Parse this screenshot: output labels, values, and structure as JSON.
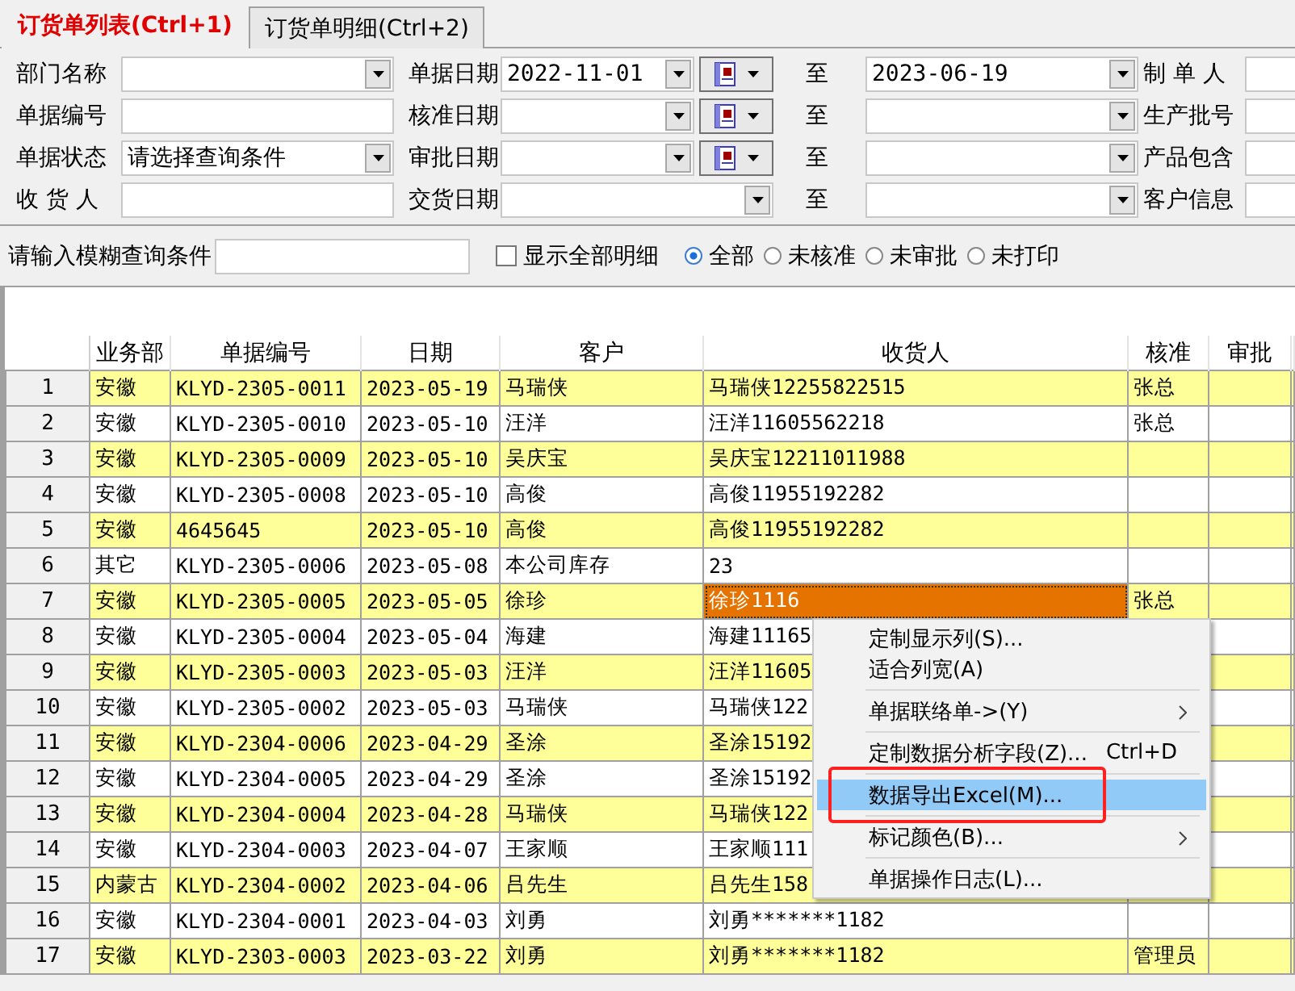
{
  "tabs": [
    {
      "label": "订货单列表(Ctrl+1)",
      "selected": true
    },
    {
      "label": "订货单明细(Ctrl+2)",
      "selected": false
    }
  ],
  "form": {
    "rows": [
      {
        "field": {
          "label": "部门名称",
          "kind": "combo"
        },
        "date": {
          "label": "单据日期",
          "value": "2022-11-01",
          "calendar": true
        },
        "to": {
          "label": "至",
          "value": "2023-06-19"
        },
        "extra": {
          "label": "制 单 人"
        }
      },
      {
        "field": {
          "label": "单据编号",
          "kind": "text"
        },
        "date": {
          "label": "核准日期",
          "calendar": true
        },
        "to": {
          "label": "至"
        },
        "extra": {
          "label": "生产批号"
        }
      },
      {
        "field": {
          "label": "单据状态",
          "kind": "combo",
          "value": "请选择查询条件"
        },
        "date": {
          "label": "审批日期",
          "calendar": true
        },
        "to": {
          "label": "至"
        },
        "extra": {
          "label": "产品包含"
        }
      },
      {
        "field": {
          "label": "收 货 人",
          "kind": "text"
        },
        "date": {
          "label": "交货日期",
          "calendar": false
        },
        "to": {
          "label": "至"
        },
        "extra": {
          "label": "客户信息"
        }
      }
    ]
  },
  "filter": {
    "label": "请输入模糊查询条件",
    "checkbox": {
      "label": "显示全部明细",
      "checked": false
    },
    "radios": [
      {
        "label": "全部",
        "selected": true
      },
      {
        "label": "未核准",
        "selected": false
      },
      {
        "label": "未审批",
        "selected": false
      },
      {
        "label": "未打印",
        "selected": false
      }
    ]
  },
  "grid": {
    "columns": [
      "业务部",
      "单据编号",
      "日期",
      "客户",
      "收货人",
      "核准",
      "审批"
    ],
    "rows": [
      {
        "number": "1",
        "selected": false,
        "cells": [
          "安徽",
          "KLYD-2305-0011",
          "2023-05-19",
          "马瑞侠",
          "马瑞侠12255822515",
          "张总",
          ""
        ]
      },
      {
        "number": "2",
        "selected": false,
        "cells": [
          "安徽",
          "KLYD-2305-0010",
          "2023-05-10",
          "汪洋",
          "汪洋11605562218",
          "张总",
          ""
        ]
      },
      {
        "number": "3",
        "selected": false,
        "cells": [
          "安徽",
          "KLYD-2305-0009",
          "2023-05-10",
          "吴庆宝",
          "吴庆宝12211011988",
          "",
          ""
        ]
      },
      {
        "number": "4",
        "selected": false,
        "cells": [
          "安徽",
          "KLYD-2305-0008",
          "2023-05-10",
          "高俊",
          "高俊11955192282",
          "",
          ""
        ]
      },
      {
        "number": "5",
        "selected": false,
        "cells": [
          "安徽",
          "4645645",
          "2023-05-10",
          "高俊",
          "高俊11955192282",
          "",
          ""
        ]
      },
      {
        "number": "6",
        "selected": false,
        "cells": [
          "其它",
          "KLYD-2305-0006",
          "2023-05-08",
          "本公司库存",
          "23",
          "",
          ""
        ]
      },
      {
        "number": "7",
        "selected": true,
        "cells": [
          "安徽",
          "KLYD-2305-0005",
          "2023-05-05",
          "徐珍",
          "徐珍1116",
          "张总",
          ""
        ]
      },
      {
        "number": "8",
        "selected": false,
        "cells": [
          "安徽",
          "KLYD-2305-0004",
          "2023-05-04",
          "海建",
          "海建11165",
          "",
          ""
        ]
      },
      {
        "number": "9",
        "selected": false,
        "cells": [
          "安徽",
          "KLYD-2305-0003",
          "2023-05-03",
          "汪洋",
          "汪洋11605",
          "",
          ""
        ]
      },
      {
        "number": "10",
        "selected": false,
        "cells": [
          "安徽",
          "KLYD-2305-0002",
          "2023-05-03",
          "马瑞侠",
          "马瑞侠122",
          "",
          ""
        ]
      },
      {
        "number": "11",
        "selected": false,
        "cells": [
          "安徽",
          "KLYD-2304-0006",
          "2023-04-29",
          "圣涂",
          "圣涂15192",
          "",
          ""
        ]
      },
      {
        "number": "12",
        "selected": false,
        "cells": [
          "安徽",
          "KLYD-2304-0005",
          "2023-04-29",
          "圣涂",
          "圣涂15192",
          "",
          ""
        ]
      },
      {
        "number": "13",
        "selected": false,
        "cells": [
          "安徽",
          "KLYD-2304-0004",
          "2023-04-28",
          "马瑞侠",
          "马瑞侠122",
          "",
          ""
        ]
      },
      {
        "number": "14",
        "selected": false,
        "cells": [
          "安徽",
          "KLYD-2304-0003",
          "2023-04-07",
          "王家顺",
          "王家顺111",
          "",
          ""
        ]
      },
      {
        "number": "15",
        "selected": false,
        "cells": [
          "内蒙古",
          "KLYD-2304-0002",
          "2023-04-06",
          "吕先生",
          "吕先生158",
          "",
          ""
        ]
      },
      {
        "number": "16",
        "selected": false,
        "cells": [
          "安徽",
          "KLYD-2304-0001",
          "2023-04-03",
          "刘勇",
          "刘勇*******1182",
          "",
          ""
        ]
      },
      {
        "number": "17",
        "selected": false,
        "cells": [
          "安徽",
          "KLYD-2303-0003",
          "2023-03-22",
          "刘勇",
          "刘勇*******1182",
          "管理员",
          ""
        ]
      }
    ]
  },
  "menu": {
    "items": [
      {
        "kind": "item",
        "label": "定制显示列(S)...",
        "selected": false,
        "annotated": false,
        "submenu": false
      },
      {
        "kind": "item",
        "label": "适合列宽(A)",
        "selected": false,
        "annotated": false,
        "submenu": false
      },
      {
        "kind": "separator"
      },
      {
        "kind": "item",
        "label": "单据联络单->(Y)",
        "selected": false,
        "annotated": false,
        "submenu": true
      },
      {
        "kind": "separator"
      },
      {
        "kind": "item",
        "label": "定制数据分析字段(Z)...",
        "shortcut": "Ctrl+D",
        "selected": false,
        "annotated": false,
        "submenu": false
      },
      {
        "kind": "separator"
      },
      {
        "kind": "item",
        "label": "数据导出Excel(M)...",
        "selected": true,
        "annotated": true,
        "submenu": false
      },
      {
        "kind": "separator"
      },
      {
        "kind": "item",
        "label": "标记颜色(B)...",
        "selected": false,
        "annotated": false,
        "submenu": true
      },
      {
        "kind": "separator"
      },
      {
        "kind": "item",
        "label": "单据操作日志(L)...",
        "selected": false,
        "annotated": false,
        "submenu": false
      }
    ]
  }
}
